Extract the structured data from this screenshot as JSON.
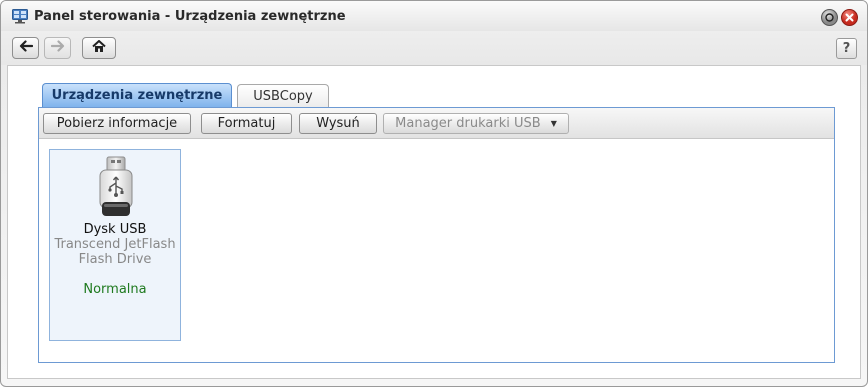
{
  "window": {
    "title": "Panel sterowania - Urządzenia zewnętrzne",
    "icons": {
      "app": "control-panel-icon",
      "minimize": "minimize-icon",
      "close": "close-icon"
    }
  },
  "toolbar": {
    "back": "back-arrow-icon",
    "forward": "forward-arrow-icon",
    "home": "home-icon",
    "help_label": "?"
  },
  "tabs": [
    {
      "label": "Urządzenia zewnętrzne",
      "active": true
    },
    {
      "label": "USBCopy",
      "active": false
    }
  ],
  "actions": {
    "info_label": "Pobierz informacje",
    "format_label": "Formatuj",
    "eject_label": "Wysuń",
    "printer_label": "Manager drukarki USB"
  },
  "devices": [
    {
      "name": "Dysk USB",
      "model": "Transcend JetFlash Flash Drive",
      "status": "Normalna",
      "icon": "usb-drive-icon"
    }
  ],
  "colors": {
    "tab_active": "#7fb3ec",
    "panel_border": "#6d9ad3",
    "status_ok": "#1f7a1f",
    "close_button": "#d9372c"
  }
}
